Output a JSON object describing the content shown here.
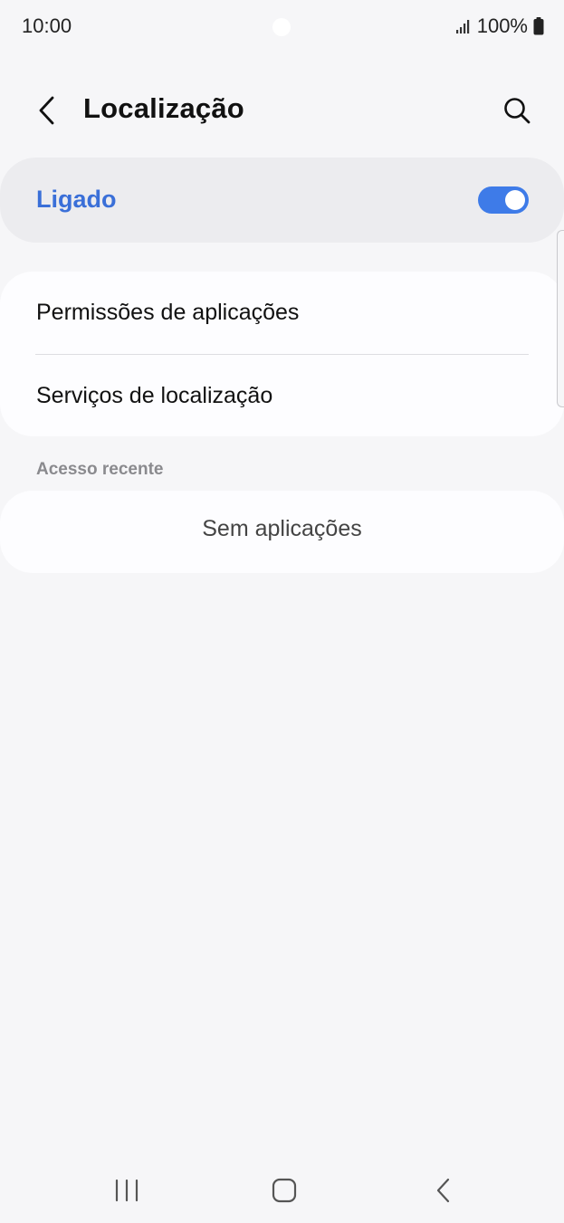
{
  "status_bar": {
    "time": "10:00",
    "battery": "100%",
    "icons": [
      "signal-icon",
      "battery-icon"
    ]
  },
  "app_bar": {
    "title": "Localização",
    "back_icon": "chevron-left-icon",
    "search_icon": "search-icon"
  },
  "master_toggle": {
    "label": "Ligado",
    "state": "on",
    "accent_color": "#3e7be8"
  },
  "settings_list": {
    "items": [
      {
        "label": "Permissões de aplicações"
      },
      {
        "label": "Serviços de localização"
      }
    ]
  },
  "recent_access": {
    "header": "Acesso recente",
    "empty_text": "Sem aplicações"
  },
  "nav_bar": {
    "icons": [
      "recents-icon",
      "home-icon",
      "back-icon"
    ]
  }
}
